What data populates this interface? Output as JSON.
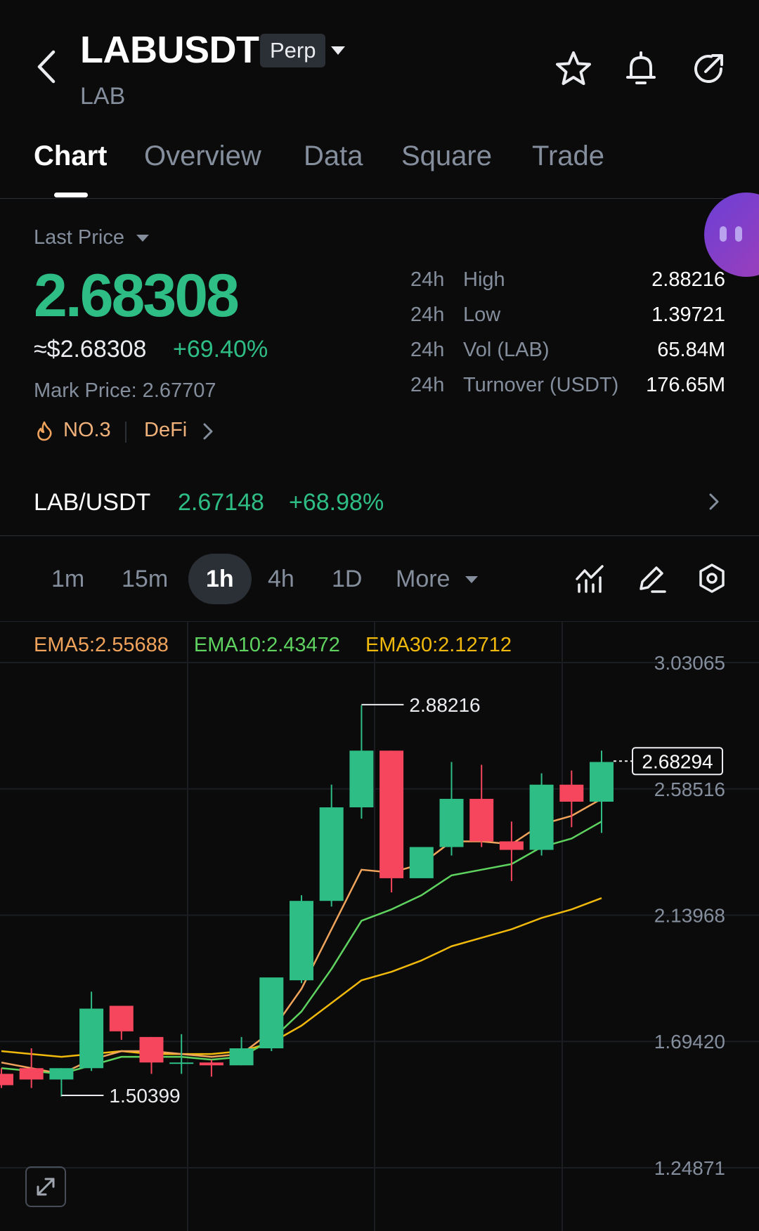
{
  "header": {
    "symbol": "LABUSDT",
    "contract_type": "Perp",
    "base_asset": "LAB"
  },
  "icons": {
    "back": "back-arrow-icon",
    "favorite": "star-icon",
    "alert": "bell-icon",
    "share": "share-icon"
  },
  "tabs": [
    {
      "label": "Chart",
      "active": true
    },
    {
      "label": "Overview",
      "active": false
    },
    {
      "label": "Data",
      "active": false
    },
    {
      "label": "Square",
      "active": false
    },
    {
      "label": "Trade",
      "active": false
    }
  ],
  "price": {
    "label": "Last Price",
    "last": "2.68308",
    "usd": "≈$2.68308",
    "change": "+69.40%",
    "mark_price": "Mark Price: 2.67707",
    "rank": "NO.3",
    "sector": "DeFi"
  },
  "stats": [
    {
      "period": "24h",
      "label": "High",
      "value": "2.88216"
    },
    {
      "period": "24h",
      "label": "Low",
      "value": "1.39721"
    },
    {
      "period": "24h",
      "label": "Vol (LAB)",
      "value": "65.84M"
    },
    {
      "period": "24h",
      "label": "Turnover (USDT)",
      "value": "176.65M"
    }
  ],
  "spot": {
    "pair": "LAB/USDT",
    "price": "2.67148",
    "change": "+68.98%"
  },
  "intervals": [
    {
      "label": "1m",
      "active": false
    },
    {
      "label": "15m",
      "active": false
    },
    {
      "label": "1h",
      "active": true
    },
    {
      "label": "4h",
      "active": false
    },
    {
      "label": "1D",
      "active": false
    }
  ],
  "more_label": "More",
  "colors": {
    "up": "#2ebd85",
    "down": "#f6465d",
    "ema5": "#f0a35a",
    "ema10": "#5fd35f",
    "ema30": "#f0b90b",
    "background": "#0b0b0c"
  },
  "chart_data": {
    "type": "candlestick",
    "interval": "1h",
    "indicators": [
      {
        "name": "EMA5",
        "value": "2.55688",
        "label": "EMA5:2.55688"
      },
      {
        "name": "EMA10",
        "value": "2.43472",
        "label": "EMA10:2.43472"
      },
      {
        "name": "EMA30",
        "value": "2.12712",
        "label": "EMA30:2.12712"
      }
    ],
    "y_ticks": [
      "3.03065",
      "2.58516",
      "2.13968",
      "1.69420",
      "1.24871"
    ],
    "y_tick_values": [
      3.03065,
      2.58516,
      2.13968,
      1.6942,
      1.24871
    ],
    "current_price_label": "2.68294",
    "current_price": 2.68294,
    "high_label": "2.88216",
    "high": 2.88216,
    "low_label": "1.50399",
    "low": 1.50399,
    "candles": [
      {
        "o": 1.58,
        "h": 1.6,
        "l": 1.53,
        "c": 1.54
      },
      {
        "o": 1.6,
        "h": 1.67,
        "l": 1.53,
        "c": 1.56
      },
      {
        "o": 1.56,
        "h": 1.6,
        "l": 1.5,
        "c": 1.6
      },
      {
        "o": 1.6,
        "h": 1.87,
        "l": 1.59,
        "c": 1.81
      },
      {
        "o": 1.82,
        "h": 1.82,
        "l": 1.7,
        "c": 1.73
      },
      {
        "o": 1.71,
        "h": 1.71,
        "l": 1.58,
        "c": 1.62
      },
      {
        "o": 1.62,
        "h": 1.72,
        "l": 1.58,
        "c": 1.62
      },
      {
        "o": 1.62,
        "h": 1.63,
        "l": 1.57,
        "c": 1.61
      },
      {
        "o": 1.61,
        "h": 1.71,
        "l": 1.61,
        "c": 1.67
      },
      {
        "o": 1.67,
        "h": 1.9,
        "l": 1.66,
        "c": 1.92
      },
      {
        "o": 1.91,
        "h": 2.21,
        "l": 1.9,
        "c": 2.19
      },
      {
        "o": 2.19,
        "h": 2.6,
        "l": 2.17,
        "c": 2.52
      },
      {
        "o": 2.52,
        "h": 2.88,
        "l": 2.48,
        "c": 2.72
      },
      {
        "o": 2.72,
        "h": 2.72,
        "l": 2.22,
        "c": 2.27
      },
      {
        "o": 2.27,
        "h": 2.35,
        "l": 2.27,
        "c": 2.38
      },
      {
        "o": 2.38,
        "h": 2.68,
        "l": 2.35,
        "c": 2.55
      },
      {
        "o": 2.55,
        "h": 2.67,
        "l": 2.38,
        "c": 2.4
      },
      {
        "o": 2.4,
        "h": 2.47,
        "l": 2.26,
        "c": 2.37
      },
      {
        "o": 2.37,
        "h": 2.64,
        "l": 2.35,
        "c": 2.6
      },
      {
        "o": 2.6,
        "h": 2.65,
        "l": 2.45,
        "c": 2.54
      },
      {
        "o": 2.54,
        "h": 2.72,
        "l": 2.43,
        "c": 2.68
      }
    ],
    "ema5": [
      1.62,
      1.6,
      1.58,
      1.63,
      1.66,
      1.66,
      1.65,
      1.64,
      1.65,
      1.73,
      1.88,
      2.09,
      2.3,
      2.29,
      2.32,
      2.4,
      2.4,
      2.39,
      2.46,
      2.49,
      2.55
    ],
    "ema10": [
      1.6,
      1.59,
      1.58,
      1.61,
      1.64,
      1.64,
      1.64,
      1.63,
      1.64,
      1.7,
      1.8,
      1.95,
      2.12,
      2.16,
      2.21,
      2.28,
      2.3,
      2.32,
      2.38,
      2.41,
      2.47
    ],
    "ema30": [
      1.66,
      1.65,
      1.64,
      1.65,
      1.66,
      1.65,
      1.65,
      1.65,
      1.66,
      1.69,
      1.75,
      1.83,
      1.91,
      1.94,
      1.98,
      2.03,
      2.06,
      2.09,
      2.13,
      2.16,
      2.2
    ]
  }
}
